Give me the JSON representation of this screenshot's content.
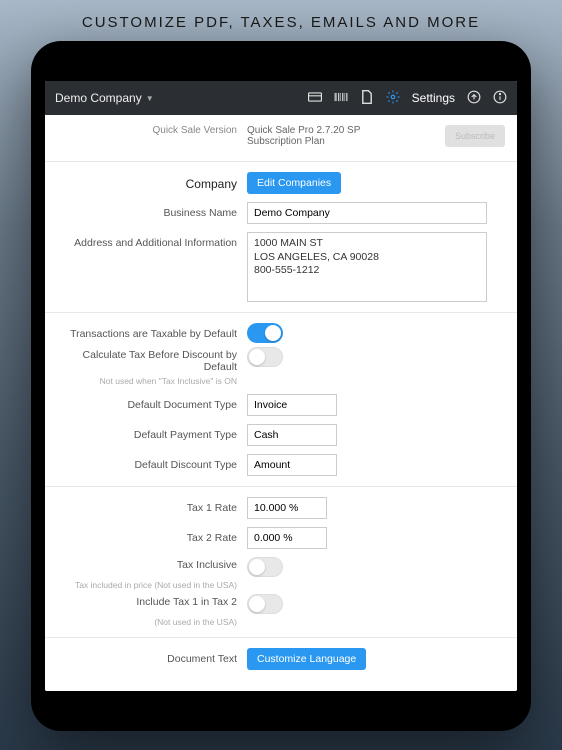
{
  "banner": "CUSTOMIZE PDF, TAXES, EMAILS AND MORE",
  "topbar": {
    "company": "Demo Company",
    "settings_label": "Settings"
  },
  "version": {
    "label": "Quick Sale Version",
    "value": "Quick Sale Pro 2.7.20  SP\nSubscription Plan",
    "subscribe": "Subscribe"
  },
  "company": {
    "section": "Company",
    "edit_btn": "Edit Companies",
    "business_name_label": "Business Name",
    "business_name": "Demo Company",
    "address_label": "Address and Additional Information",
    "address": "1000 MAIN ST\nLOS ANGELES, CA 90028\n800-555-1212"
  },
  "defaults": {
    "taxable_label": "Transactions are Taxable by Default",
    "taxable": true,
    "tax_before_discount_label": "Calculate Tax Before Discount by Default",
    "tax_before_discount": false,
    "tax_before_discount_helper": "Not used when \"Tax Inclusive\" is ON",
    "doc_type_label": "Default Document Type",
    "doc_type": "Invoice",
    "payment_type_label": "Default Payment Type",
    "payment_type": "Cash",
    "discount_type_label": "Default Discount Type",
    "discount_type": "Amount"
  },
  "tax": {
    "rate1_label": "Tax 1 Rate",
    "rate1": "10.000 %",
    "rate2_label": "Tax 2 Rate",
    "rate2": "0.000 %",
    "inclusive_label": "Tax Inclusive",
    "inclusive": false,
    "inclusive_helper": "Tax included in price (Not used in the USA)",
    "include_1in2_label": "Include Tax 1 in Tax 2",
    "include_1in2": false,
    "include_1in2_helper": "(Not used in the USA)"
  },
  "doc_text": {
    "label": "Document Text",
    "btn": "Customize Language"
  }
}
